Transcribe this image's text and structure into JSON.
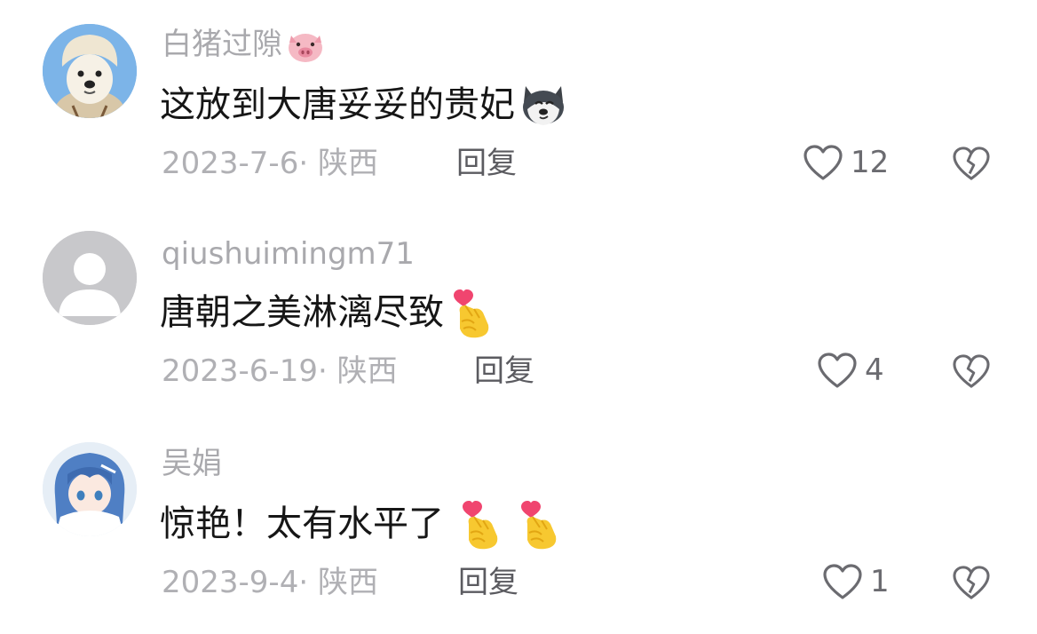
{
  "comments": [
    {
      "username": "白猪过隙",
      "username_emoji": "pig-face",
      "text": "这放到大唐妥妥的贵妃",
      "text_emojis": [
        "husky-dog"
      ],
      "date": "2023-7-6",
      "location": "陕西",
      "reply_label": "回复",
      "likes": "12",
      "avatar": "dog-in-hat-avatar"
    },
    {
      "username": "qiushuimingm71",
      "username_emoji": null,
      "text": "唐朝之美淋漓尽致",
      "text_emojis": [
        "finger-heart"
      ],
      "date": "2023-6-19",
      "location": "陕西",
      "reply_label": "回复",
      "likes": "4",
      "avatar": "default-gray-avatar"
    },
    {
      "username": "吴娟",
      "username_emoji": null,
      "text": "惊艳！太有水平了",
      "text_emojis": [
        "finger-heart",
        "finger-heart"
      ],
      "date": "2023-9-4",
      "location": "陕西",
      "reply_label": "回复",
      "likes": "1",
      "avatar": "anime-girl-avatar"
    }
  ],
  "meta_separator": "·",
  "colors": {
    "username": "#a9a9ad",
    "content": "#161616",
    "meta": "#b0b0b4",
    "reply": "#5b5b60",
    "icon_stroke": "#6b6b70"
  }
}
